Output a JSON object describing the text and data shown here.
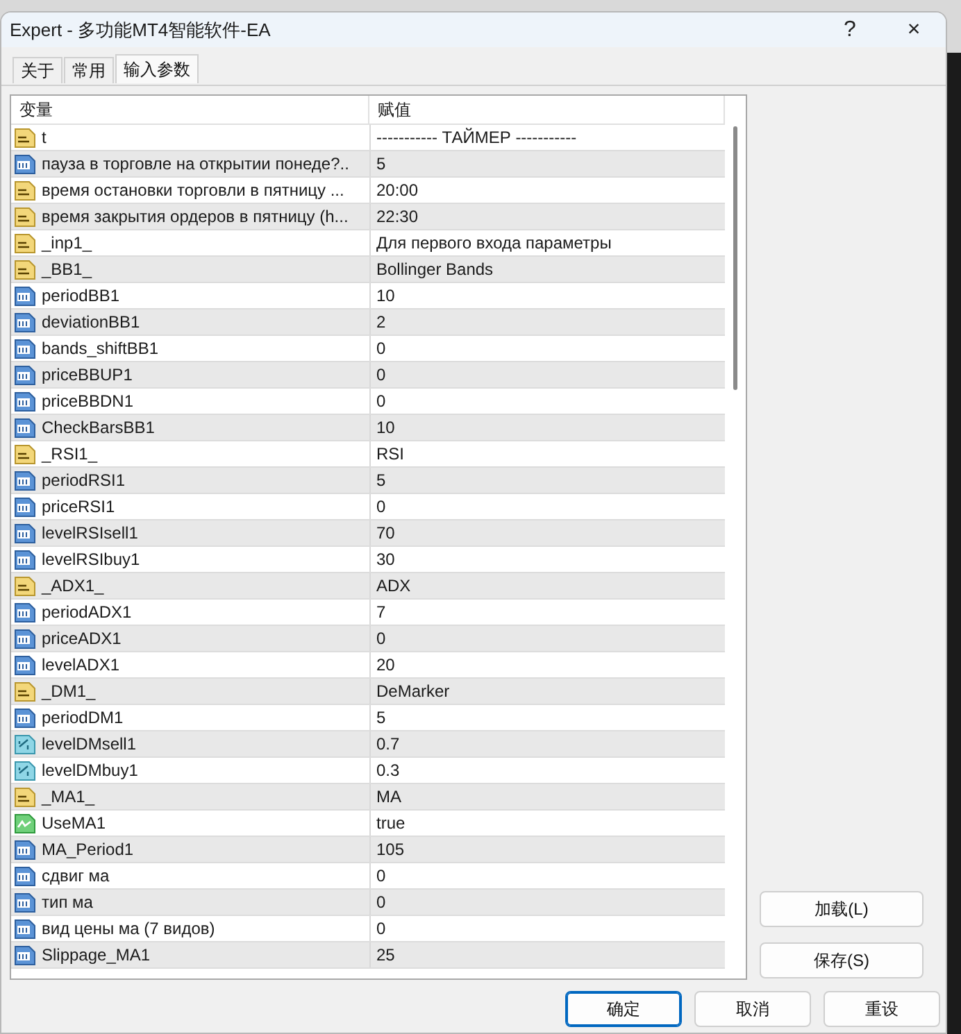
{
  "window": {
    "title": "Expert - 多功能MT4智能软件-EA",
    "help": "?",
    "close": "×"
  },
  "tabs": [
    {
      "label": "关于",
      "selected": false
    },
    {
      "label": "常用",
      "selected": false
    },
    {
      "label": "输入参数",
      "selected": true
    }
  ],
  "table": {
    "columns": [
      "变量",
      "赋值"
    ],
    "rows": [
      {
        "kind": "string",
        "name": "t",
        "value": "----------- ТАЙМЕР -----------"
      },
      {
        "kind": "int",
        "name": "пауза в торговле на открытии понеде?..",
        "value": "5"
      },
      {
        "kind": "string",
        "name": "время остановки торговли в пятницу ...",
        "value": "20:00"
      },
      {
        "kind": "string",
        "name": "время закрытия ордеров в пятницу (h...",
        "value": "22:30"
      },
      {
        "kind": "string",
        "name": "_inp1_",
        "value": "Для первого входа параметры"
      },
      {
        "kind": "string",
        "name": "_BB1_",
        "value": "Bollinger Bands"
      },
      {
        "kind": "int",
        "name": "periodBB1",
        "value": "10"
      },
      {
        "kind": "int",
        "name": "deviationBB1",
        "value": "2"
      },
      {
        "kind": "int",
        "name": "bands_shiftBB1",
        "value": "0"
      },
      {
        "kind": "int",
        "name": "priceBBUP1",
        "value": "0"
      },
      {
        "kind": "int",
        "name": "priceBBDN1",
        "value": "0"
      },
      {
        "kind": "int",
        "name": "CheckBarsBB1",
        "value": "10"
      },
      {
        "kind": "string",
        "name": "_RSI1_",
        "value": "RSI"
      },
      {
        "kind": "int",
        "name": "periodRSI1",
        "value": "5"
      },
      {
        "kind": "int",
        "name": "priceRSI1",
        "value": "0"
      },
      {
        "kind": "int",
        "name": "levelRSIsell1",
        "value": "70"
      },
      {
        "kind": "int",
        "name": "levelRSIbuy1",
        "value": "30"
      },
      {
        "kind": "string",
        "name": "_ADX1_",
        "value": "ADX"
      },
      {
        "kind": "int",
        "name": "periodADX1",
        "value": "7"
      },
      {
        "kind": "int",
        "name": "priceADX1",
        "value": "0"
      },
      {
        "kind": "int",
        "name": "levelADX1",
        "value": "20"
      },
      {
        "kind": "string",
        "name": "_DM1_",
        "value": "DeMarker"
      },
      {
        "kind": "int",
        "name": "periodDM1",
        "value": "5"
      },
      {
        "kind": "double",
        "name": "levelDMsell1",
        "value": "0.7"
      },
      {
        "kind": "double",
        "name": "levelDMbuy1",
        "value": "0.3"
      },
      {
        "kind": "string",
        "name": "_MA1_",
        "value": "MA"
      },
      {
        "kind": "bool",
        "name": "UseMA1",
        "value": "true"
      },
      {
        "kind": "int",
        "name": "MA_Period1",
        "value": "105"
      },
      {
        "kind": "int",
        "name": "сдвиг ма",
        "value": "0"
      },
      {
        "kind": "int",
        "name": "тип ма",
        "value": "0"
      },
      {
        "kind": "int",
        "name": "вид цены ма (7 видов)",
        "value": "0"
      },
      {
        "kind": "int",
        "name": "Slippage_MA1",
        "value": "25"
      }
    ]
  },
  "side_buttons": [
    "加载(L)",
    "保存(S)"
  ],
  "buttons": [
    {
      "label": "确定",
      "default": true
    },
    {
      "label": "取消",
      "default": false
    },
    {
      "label": "重设",
      "default": false
    }
  ]
}
